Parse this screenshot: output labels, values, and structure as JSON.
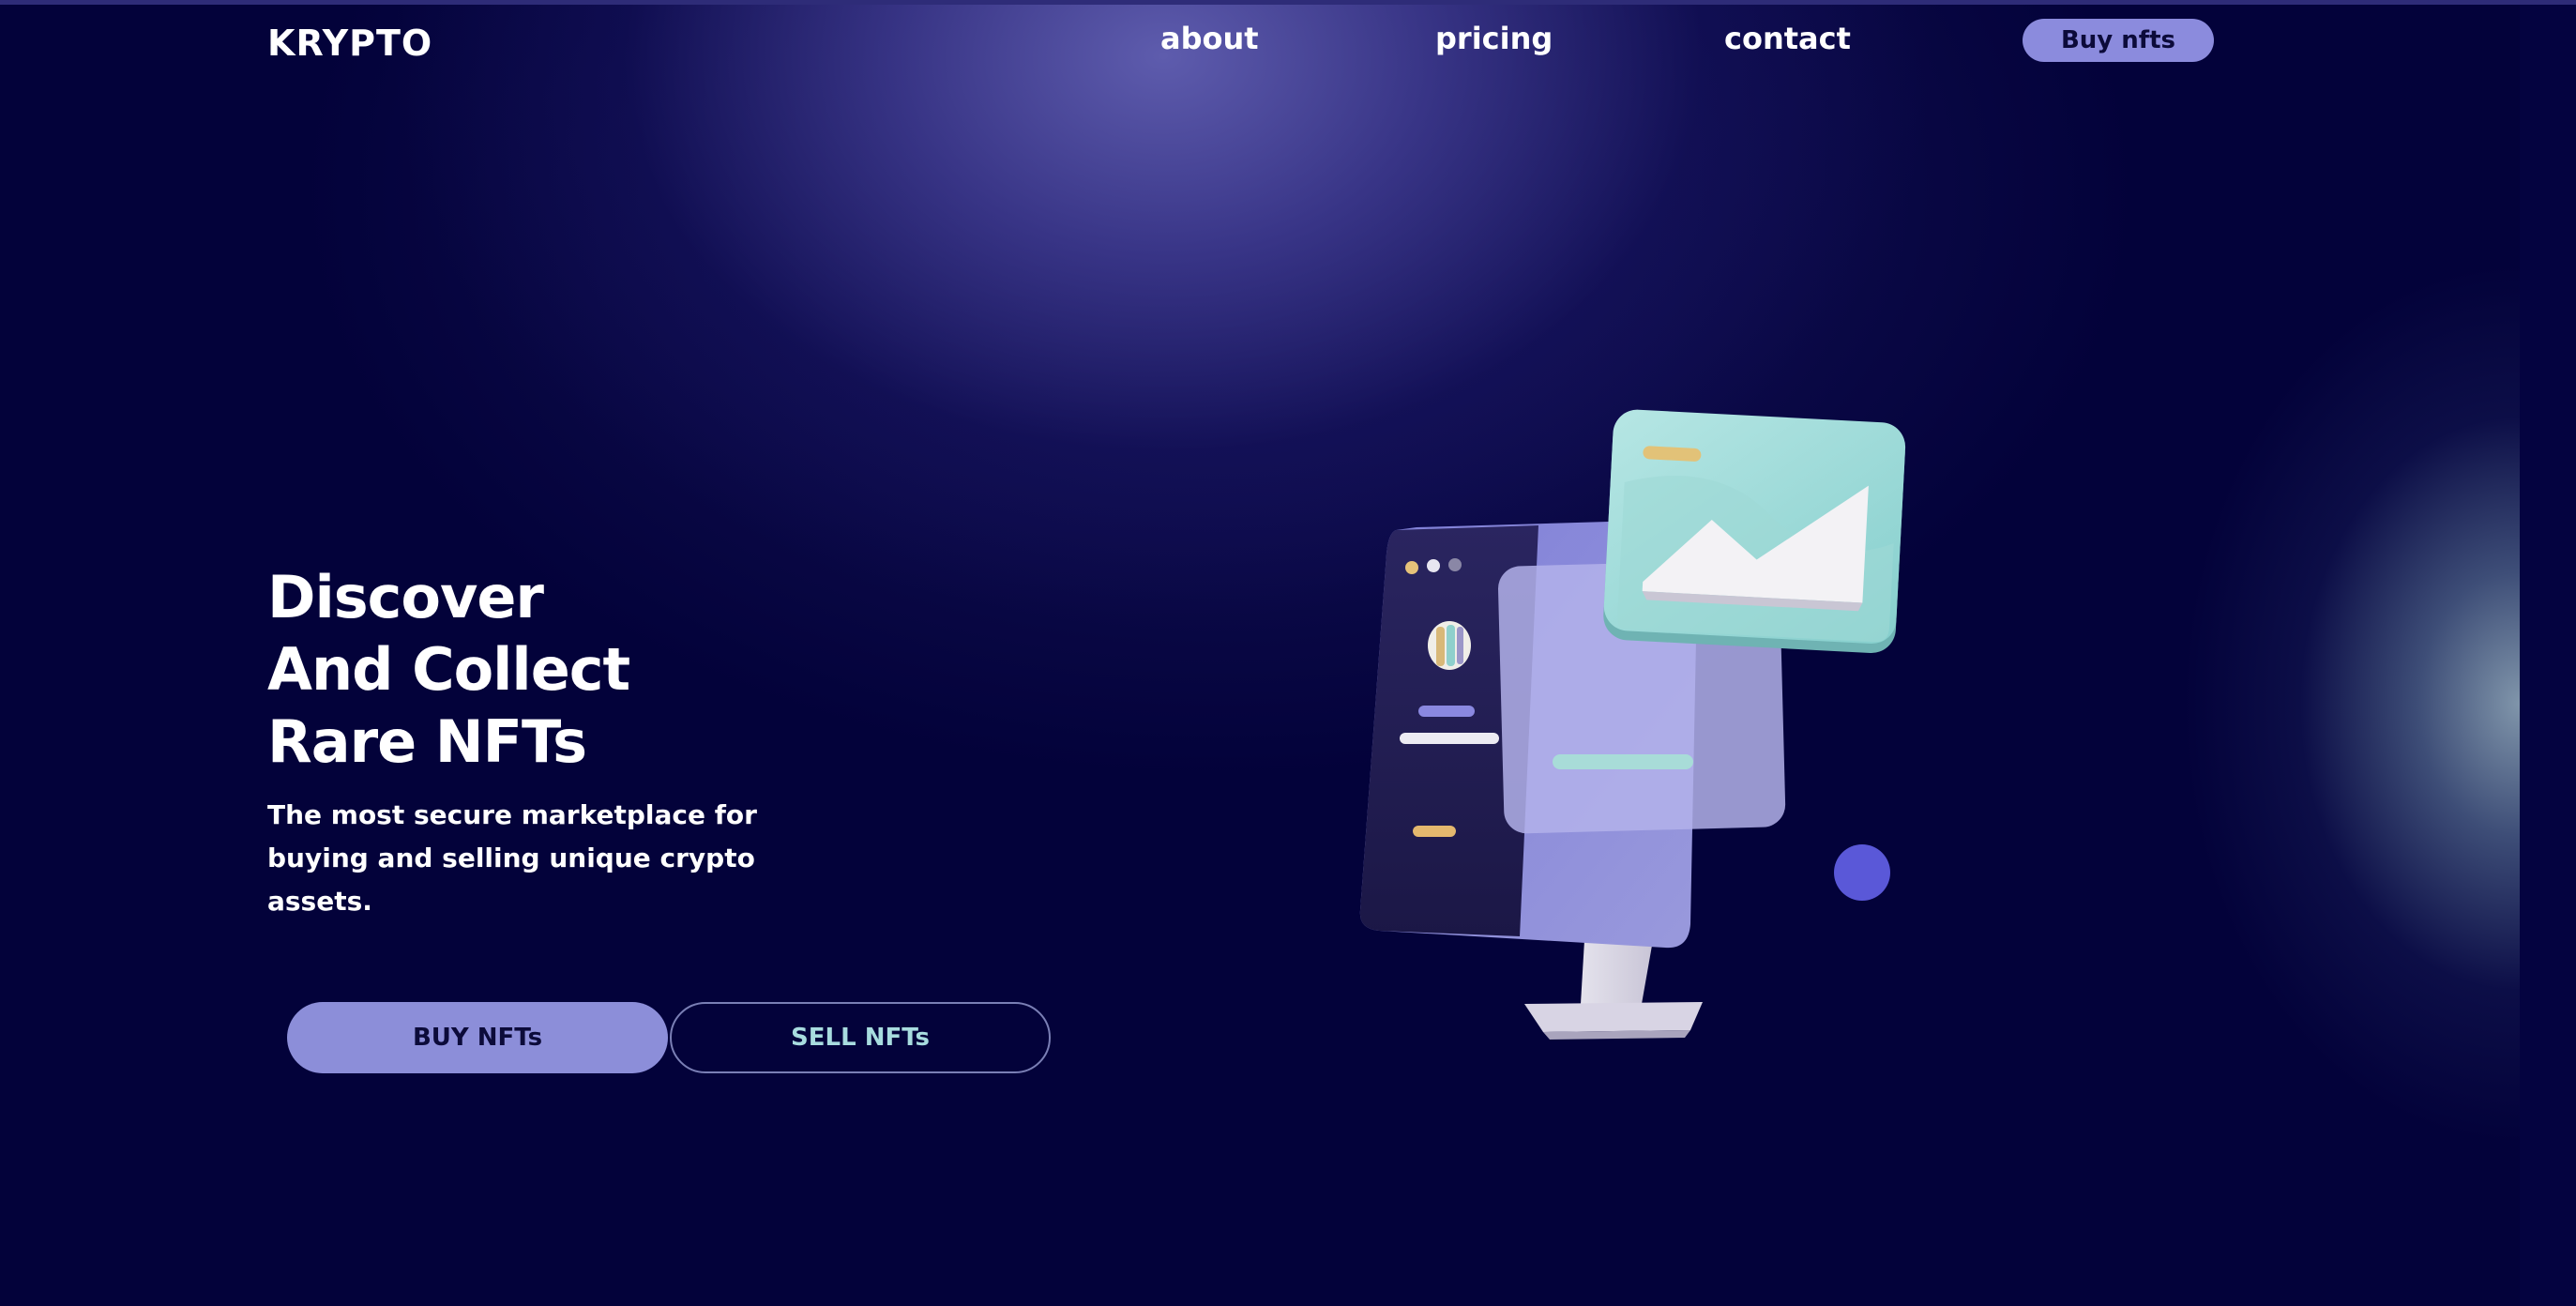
{
  "header": {
    "logo": "KRYPTO",
    "nav": {
      "about": "about",
      "pricing": "pricing",
      "contact": "contact"
    },
    "cta": "Buy nfts"
  },
  "hero": {
    "title_lines": [
      "Discover",
      "And Collect",
      "Rare NFTs"
    ],
    "subtitle": "The most secure marketplace for buying and selling unique crypto assets.",
    "buy_button": "BUY NFTs",
    "sell_button": "SELL NFTs"
  },
  "illustration": {
    "icon": "nft-monitor-illustration"
  },
  "colors": {
    "background": "#03023a",
    "accent": "#8b8bdd",
    "secondary_text": "#a8dcdf"
  }
}
